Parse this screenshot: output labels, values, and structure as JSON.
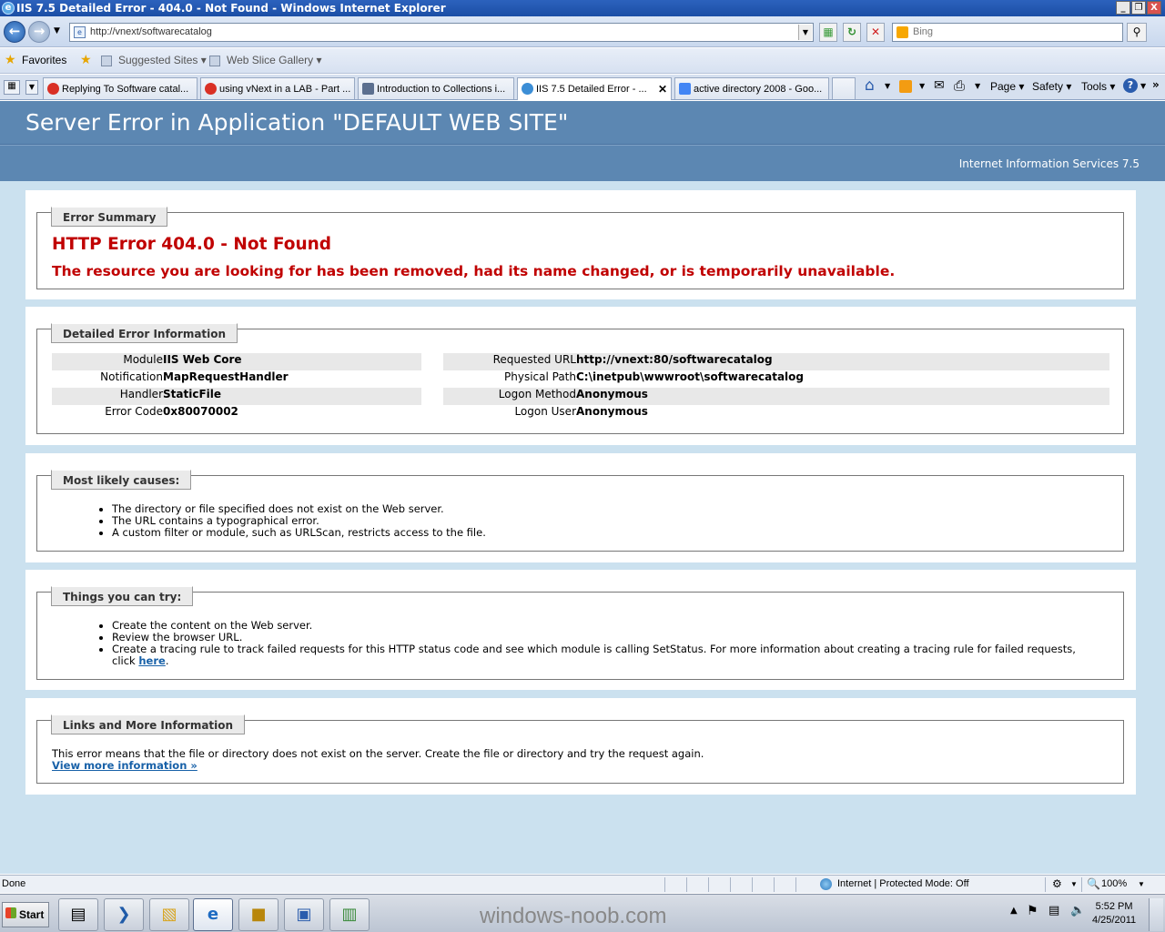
{
  "window": {
    "title": "IIS 7.5 Detailed Error - 404.0 - Not Found - Windows Internet Explorer",
    "min": "_",
    "max": "❐",
    "close": "X"
  },
  "nav": {
    "url": "http://vnext/softwarecatalog",
    "search_placeholder": "Bing"
  },
  "favorites": {
    "label": "Favorites",
    "suggested": "Suggested Sites",
    "gallery": "Web Slice Gallery"
  },
  "tabs": [
    {
      "label": "Replying To Software catal...",
      "color": "#d93025"
    },
    {
      "label": "using vNext in a LAB - Part ...",
      "color": "#d93025"
    },
    {
      "label": "Introduction to Collections i...",
      "color": "#5b6f8f"
    },
    {
      "label": "IIS 7.5 Detailed Error - ...",
      "color": "#3c8ed6",
      "active": true
    },
    {
      "label": "active directory 2008 - Goo...",
      "color": "#4285f4"
    }
  ],
  "commandbar": {
    "page": "Page",
    "safety": "Safety",
    "tools": "Tools"
  },
  "page": {
    "header": "Server Error in Application \"DEFAULT WEB SITE\"",
    "iis_version": "Internet Information Services 7.5",
    "summary": {
      "legend": "Error Summary",
      "title": "HTTP Error 404.0 - Not Found",
      "message": "The resource you are looking for has been removed, had its name changed, or is temporarily unavailable."
    },
    "details": {
      "legend": "Detailed Error Information",
      "left": [
        {
          "key": "Module",
          "value": "IIS Web Core"
        },
        {
          "key": "Notification",
          "value": "MapRequestHandler"
        },
        {
          "key": "Handler",
          "value": "StaticFile"
        },
        {
          "key": "Error Code",
          "value": "0x80070002"
        }
      ],
      "right": [
        {
          "key": "Requested URL",
          "value": "http://vnext:80/softwarecatalog"
        },
        {
          "key": "Physical Path",
          "value": "C:\\inetpub\\wwwroot\\softwarecatalog"
        },
        {
          "key": "Logon Method",
          "value": "Anonymous"
        },
        {
          "key": "Logon User",
          "value": "Anonymous"
        }
      ]
    },
    "causes": {
      "legend": "Most likely causes:",
      "items": [
        "The directory or file specified does not exist on the Web server.",
        "The URL contains a typographical error.",
        "A custom filter or module, such as URLScan, restricts access to the file."
      ]
    },
    "try": {
      "legend": "Things you can try:",
      "items": [
        "Create the content on the Web server.",
        "Review the browser URL.",
        "Create a tracing rule to track failed requests for this HTTP status code and see which module is calling SetStatus. For more information about creating a tracing rule for failed requests, click"
      ],
      "link": "here",
      "link_suffix": "."
    },
    "links": {
      "legend": "Links and More Information",
      "text": "This error means that the file or directory does not exist on the server. Create the file or directory and try the request again.",
      "more": "View more information »"
    }
  },
  "status": {
    "left": "Done",
    "zone": "Internet | Protected Mode: Off",
    "zoom": "100%"
  },
  "taskbar": {
    "start": "Start",
    "watermark": "windows-noob.com",
    "time": "5:52 PM",
    "date": "4/25/2011"
  }
}
